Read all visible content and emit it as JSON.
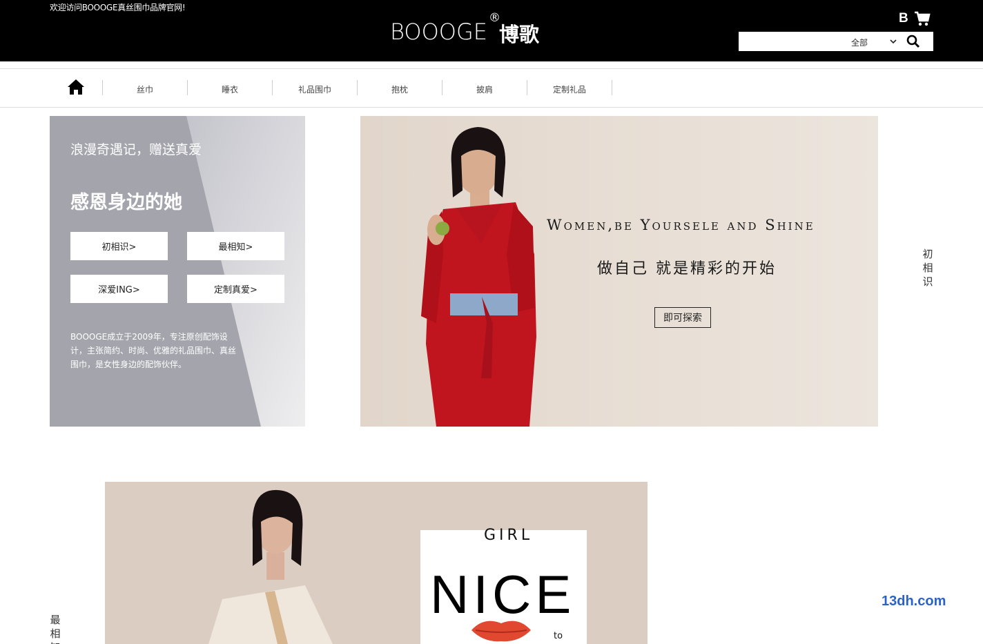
{
  "header": {
    "welcome": "欢迎访问BOOOGE真丝围巾品牌官网!",
    "logo_en": "BOOOGE",
    "logo_reg": "®",
    "logo_cn": "博歌",
    "account_letter": "B",
    "search": {
      "category": "全部",
      "placeholder": ""
    }
  },
  "nav": {
    "items": [
      {
        "label": "丝巾"
      },
      {
        "label": "睡衣"
      },
      {
        "label": "礼品围巾"
      },
      {
        "label": "抱枕"
      },
      {
        "label": "披肩"
      },
      {
        "label": "定制礼品"
      }
    ]
  },
  "promo": {
    "subtitle": "浪漫奇遇记，赠送真爱",
    "title": "感恩身边的她",
    "buttons": [
      "初相识>",
      "最相知>",
      "深爱ING>",
      "定制真爱>"
    ],
    "description": "BOOOGE成立于2009年，专注原创配饰设计，主张简约、时尚、优雅的礼品围巾、真丝围巾，是女性身边的配饰伙伴。"
  },
  "hero": {
    "headline_en": "Women,be Yoursele and Shine",
    "headline_cn": "做自己 就是精彩的开始",
    "cta": "即可探索"
  },
  "side_tags": {
    "right": "初相识",
    "left": "最相知"
  },
  "feature": {
    "card_top": "GIRL",
    "card_main": "NICE",
    "card_small": "to"
  },
  "watermark": "13dh.com",
  "colors": {
    "header_bg": "#000000",
    "hero_bg": "#e7ddd4",
    "promo_gray": "#a4a4ad",
    "dress_red": "#c0141f",
    "watermark_blue": "#2a62c9"
  }
}
